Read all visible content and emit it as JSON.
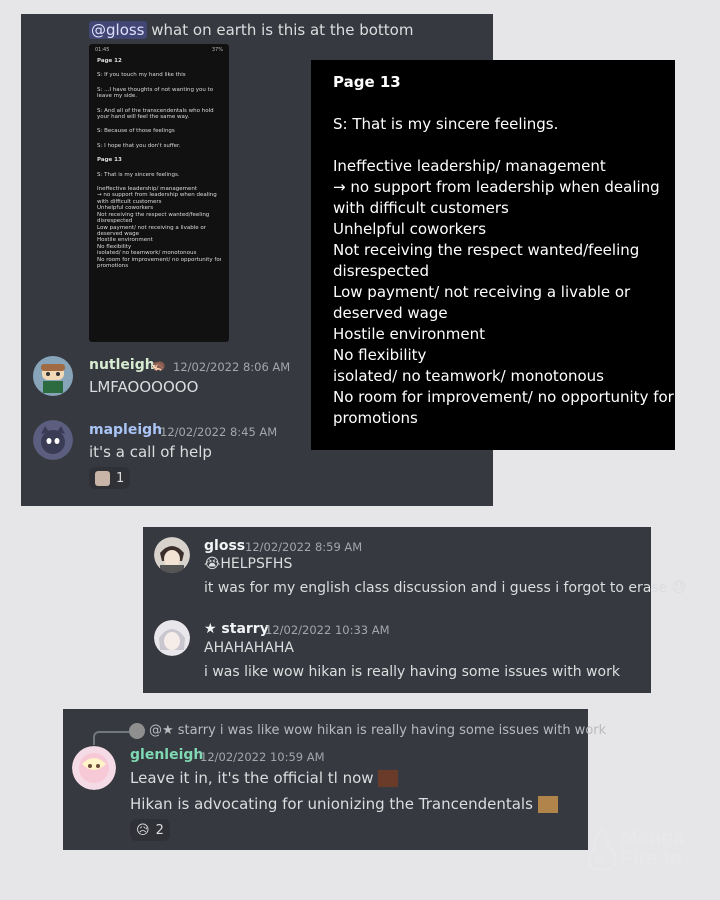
{
  "panel1": {
    "mention": "@gloss",
    "text": "what on earth is this at the bottom",
    "phone": {
      "status_time": "01:45",
      "status_right": "37%",
      "lines": [
        {
          "t": "Page 12",
          "b": true
        },
        {
          "t": ""
        },
        {
          "t": "S: If you touch my hand like this"
        },
        {
          "t": ""
        },
        {
          "t": "S: ...I have thoughts of not wanting you to"
        },
        {
          "t": "leave my side."
        },
        {
          "t": ""
        },
        {
          "t": "S: And all of the transcendentals who hold"
        },
        {
          "t": "your hand will feel the same way."
        },
        {
          "t": ""
        },
        {
          "t": "S: Because of those feelings"
        },
        {
          "t": ""
        },
        {
          "t": "S: I hope that you don't suffer."
        },
        {
          "t": ""
        },
        {
          "t": "Page 13",
          "b": true
        },
        {
          "t": ""
        },
        {
          "t": "S: That is my sincere feelings."
        },
        {
          "t": ""
        },
        {
          "t": "Ineffective leadership/ management"
        },
        {
          "t": "→ no support from leadership when dealing"
        },
        {
          "t": "with difficult customers"
        },
        {
          "t": "Unhelpful coworkers"
        },
        {
          "t": "Not receiving the respect wanted/feeling"
        },
        {
          "t": "disrespected"
        },
        {
          "t": "Low payment/ not receiving a livable or"
        },
        {
          "t": "deserved wage"
        },
        {
          "t": "Hostile environment"
        },
        {
          "t": "No flexibility"
        },
        {
          "t": "isolated/ no teamwork/ monotonous"
        },
        {
          "t": "No room for improvement/ no opportunity for"
        },
        {
          "t": "promotions"
        }
      ]
    },
    "msg2": {
      "name": "nutleigh",
      "timestamp": "12/02/2022 8:06 AM",
      "text": "LMFAOOOOOO"
    },
    "msg3": {
      "name": "mapleigh",
      "timestamp": "12/02/2022 8:45 AM",
      "text": "it's a call of help",
      "reaction_count": "1"
    }
  },
  "zoom": {
    "lines": [
      {
        "t": "Page 13",
        "b": true
      },
      {
        "t": ""
      },
      {
        "t": "S: That is my sincere feelings."
      },
      {
        "t": ""
      },
      {
        "t": "Ineffective leadership/ management"
      },
      {
        "t": "→ no support from leadership when dealing"
      },
      {
        "t": "with difficult customers"
      },
      {
        "t": "Unhelpful coworkers"
      },
      {
        "t": "Not receiving the respect wanted/feeling"
      },
      {
        "t": "disrespected"
      },
      {
        "t": "Low payment/ not receiving a livable or"
      },
      {
        "t": "deserved wage"
      },
      {
        "t": "Hostile environment"
      },
      {
        "t": "No flexibility"
      },
      {
        "t": "isolated/ no teamwork/ monotonous"
      },
      {
        "t": "No room for improvement/ no opportunity for"
      },
      {
        "t": "promotions"
      }
    ]
  },
  "panel2": {
    "msg1": {
      "name": "gloss",
      "timestamp": "12/02/2022 8:59 AM",
      "line1": "HELPSFHS",
      "line2": "it was for my english class discussion and i guess i forgot to erase"
    },
    "msg2": {
      "name": "★ starry",
      "timestamp": "12/02/2022 10:33 AM",
      "line1": "AHAHAHAHA",
      "line2": "i was like wow hikan is really having some issues with work"
    }
  },
  "panel3": {
    "reply": {
      "name": "@★ starry",
      "text": "i was like wow hikan is really having some issues with work"
    },
    "msg": {
      "name": "glenleigh",
      "timestamp": "12/02/2022 10:59 AM",
      "line1": "Leave it in, it's the official tl now",
      "line2": "Hikan is advocating for unionizing the Trancendentals",
      "reaction_count": "2"
    }
  },
  "watermark": {
    "line1": "Manga",
    "line2": "Fire.to"
  },
  "colors": {
    "panel_bg": "#36393f",
    "nutleigh": "#d7ecd1",
    "mapleigh": "#a9c4f5",
    "gloss": "#f2f3f5",
    "starry": "#f2f3f5",
    "glenleigh": "#7fd9b3"
  }
}
